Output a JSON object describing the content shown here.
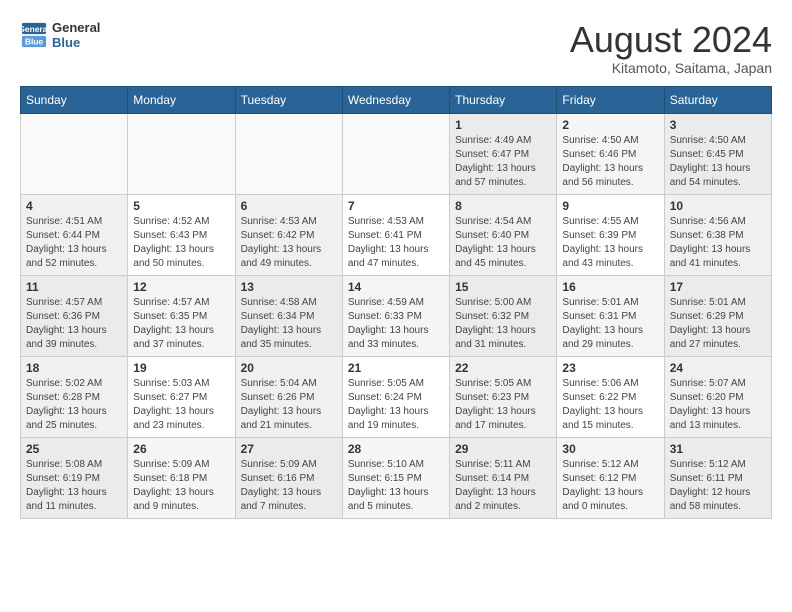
{
  "header": {
    "logo_line1": "General",
    "logo_line2": "Blue",
    "month_year": "August 2024",
    "location": "Kitamoto, Saitama, Japan"
  },
  "weekdays": [
    "Sunday",
    "Monday",
    "Tuesday",
    "Wednesday",
    "Thursday",
    "Friday",
    "Saturday"
  ],
  "weeks": [
    [
      {
        "day": "",
        "info": ""
      },
      {
        "day": "",
        "info": ""
      },
      {
        "day": "",
        "info": ""
      },
      {
        "day": "",
        "info": ""
      },
      {
        "day": "1",
        "info": "Sunrise: 4:49 AM\nSunset: 6:47 PM\nDaylight: 13 hours\nand 57 minutes."
      },
      {
        "day": "2",
        "info": "Sunrise: 4:50 AM\nSunset: 6:46 PM\nDaylight: 13 hours\nand 56 minutes."
      },
      {
        "day": "3",
        "info": "Sunrise: 4:50 AM\nSunset: 6:45 PM\nDaylight: 13 hours\nand 54 minutes."
      }
    ],
    [
      {
        "day": "4",
        "info": "Sunrise: 4:51 AM\nSunset: 6:44 PM\nDaylight: 13 hours\nand 52 minutes."
      },
      {
        "day": "5",
        "info": "Sunrise: 4:52 AM\nSunset: 6:43 PM\nDaylight: 13 hours\nand 50 minutes."
      },
      {
        "day": "6",
        "info": "Sunrise: 4:53 AM\nSunset: 6:42 PM\nDaylight: 13 hours\nand 49 minutes."
      },
      {
        "day": "7",
        "info": "Sunrise: 4:53 AM\nSunset: 6:41 PM\nDaylight: 13 hours\nand 47 minutes."
      },
      {
        "day": "8",
        "info": "Sunrise: 4:54 AM\nSunset: 6:40 PM\nDaylight: 13 hours\nand 45 minutes."
      },
      {
        "day": "9",
        "info": "Sunrise: 4:55 AM\nSunset: 6:39 PM\nDaylight: 13 hours\nand 43 minutes."
      },
      {
        "day": "10",
        "info": "Sunrise: 4:56 AM\nSunset: 6:38 PM\nDaylight: 13 hours\nand 41 minutes."
      }
    ],
    [
      {
        "day": "11",
        "info": "Sunrise: 4:57 AM\nSunset: 6:36 PM\nDaylight: 13 hours\nand 39 minutes."
      },
      {
        "day": "12",
        "info": "Sunrise: 4:57 AM\nSunset: 6:35 PM\nDaylight: 13 hours\nand 37 minutes."
      },
      {
        "day": "13",
        "info": "Sunrise: 4:58 AM\nSunset: 6:34 PM\nDaylight: 13 hours\nand 35 minutes."
      },
      {
        "day": "14",
        "info": "Sunrise: 4:59 AM\nSunset: 6:33 PM\nDaylight: 13 hours\nand 33 minutes."
      },
      {
        "day": "15",
        "info": "Sunrise: 5:00 AM\nSunset: 6:32 PM\nDaylight: 13 hours\nand 31 minutes."
      },
      {
        "day": "16",
        "info": "Sunrise: 5:01 AM\nSunset: 6:31 PM\nDaylight: 13 hours\nand 29 minutes."
      },
      {
        "day": "17",
        "info": "Sunrise: 5:01 AM\nSunset: 6:29 PM\nDaylight: 13 hours\nand 27 minutes."
      }
    ],
    [
      {
        "day": "18",
        "info": "Sunrise: 5:02 AM\nSunset: 6:28 PM\nDaylight: 13 hours\nand 25 minutes."
      },
      {
        "day": "19",
        "info": "Sunrise: 5:03 AM\nSunset: 6:27 PM\nDaylight: 13 hours\nand 23 minutes."
      },
      {
        "day": "20",
        "info": "Sunrise: 5:04 AM\nSunset: 6:26 PM\nDaylight: 13 hours\nand 21 minutes."
      },
      {
        "day": "21",
        "info": "Sunrise: 5:05 AM\nSunset: 6:24 PM\nDaylight: 13 hours\nand 19 minutes."
      },
      {
        "day": "22",
        "info": "Sunrise: 5:05 AM\nSunset: 6:23 PM\nDaylight: 13 hours\nand 17 minutes."
      },
      {
        "day": "23",
        "info": "Sunrise: 5:06 AM\nSunset: 6:22 PM\nDaylight: 13 hours\nand 15 minutes."
      },
      {
        "day": "24",
        "info": "Sunrise: 5:07 AM\nSunset: 6:20 PM\nDaylight: 13 hours\nand 13 minutes."
      }
    ],
    [
      {
        "day": "25",
        "info": "Sunrise: 5:08 AM\nSunset: 6:19 PM\nDaylight: 13 hours\nand 11 minutes."
      },
      {
        "day": "26",
        "info": "Sunrise: 5:09 AM\nSunset: 6:18 PM\nDaylight: 13 hours\nand 9 minutes."
      },
      {
        "day": "27",
        "info": "Sunrise: 5:09 AM\nSunset: 6:16 PM\nDaylight: 13 hours\nand 7 minutes."
      },
      {
        "day": "28",
        "info": "Sunrise: 5:10 AM\nSunset: 6:15 PM\nDaylight: 13 hours\nand 5 minutes."
      },
      {
        "day": "29",
        "info": "Sunrise: 5:11 AM\nSunset: 6:14 PM\nDaylight: 13 hours\nand 2 minutes."
      },
      {
        "day": "30",
        "info": "Sunrise: 5:12 AM\nSunset: 6:12 PM\nDaylight: 13 hours\nand 0 minutes."
      },
      {
        "day": "31",
        "info": "Sunrise: 5:12 AM\nSunset: 6:11 PM\nDaylight: 12 hours\nand 58 minutes."
      }
    ]
  ]
}
